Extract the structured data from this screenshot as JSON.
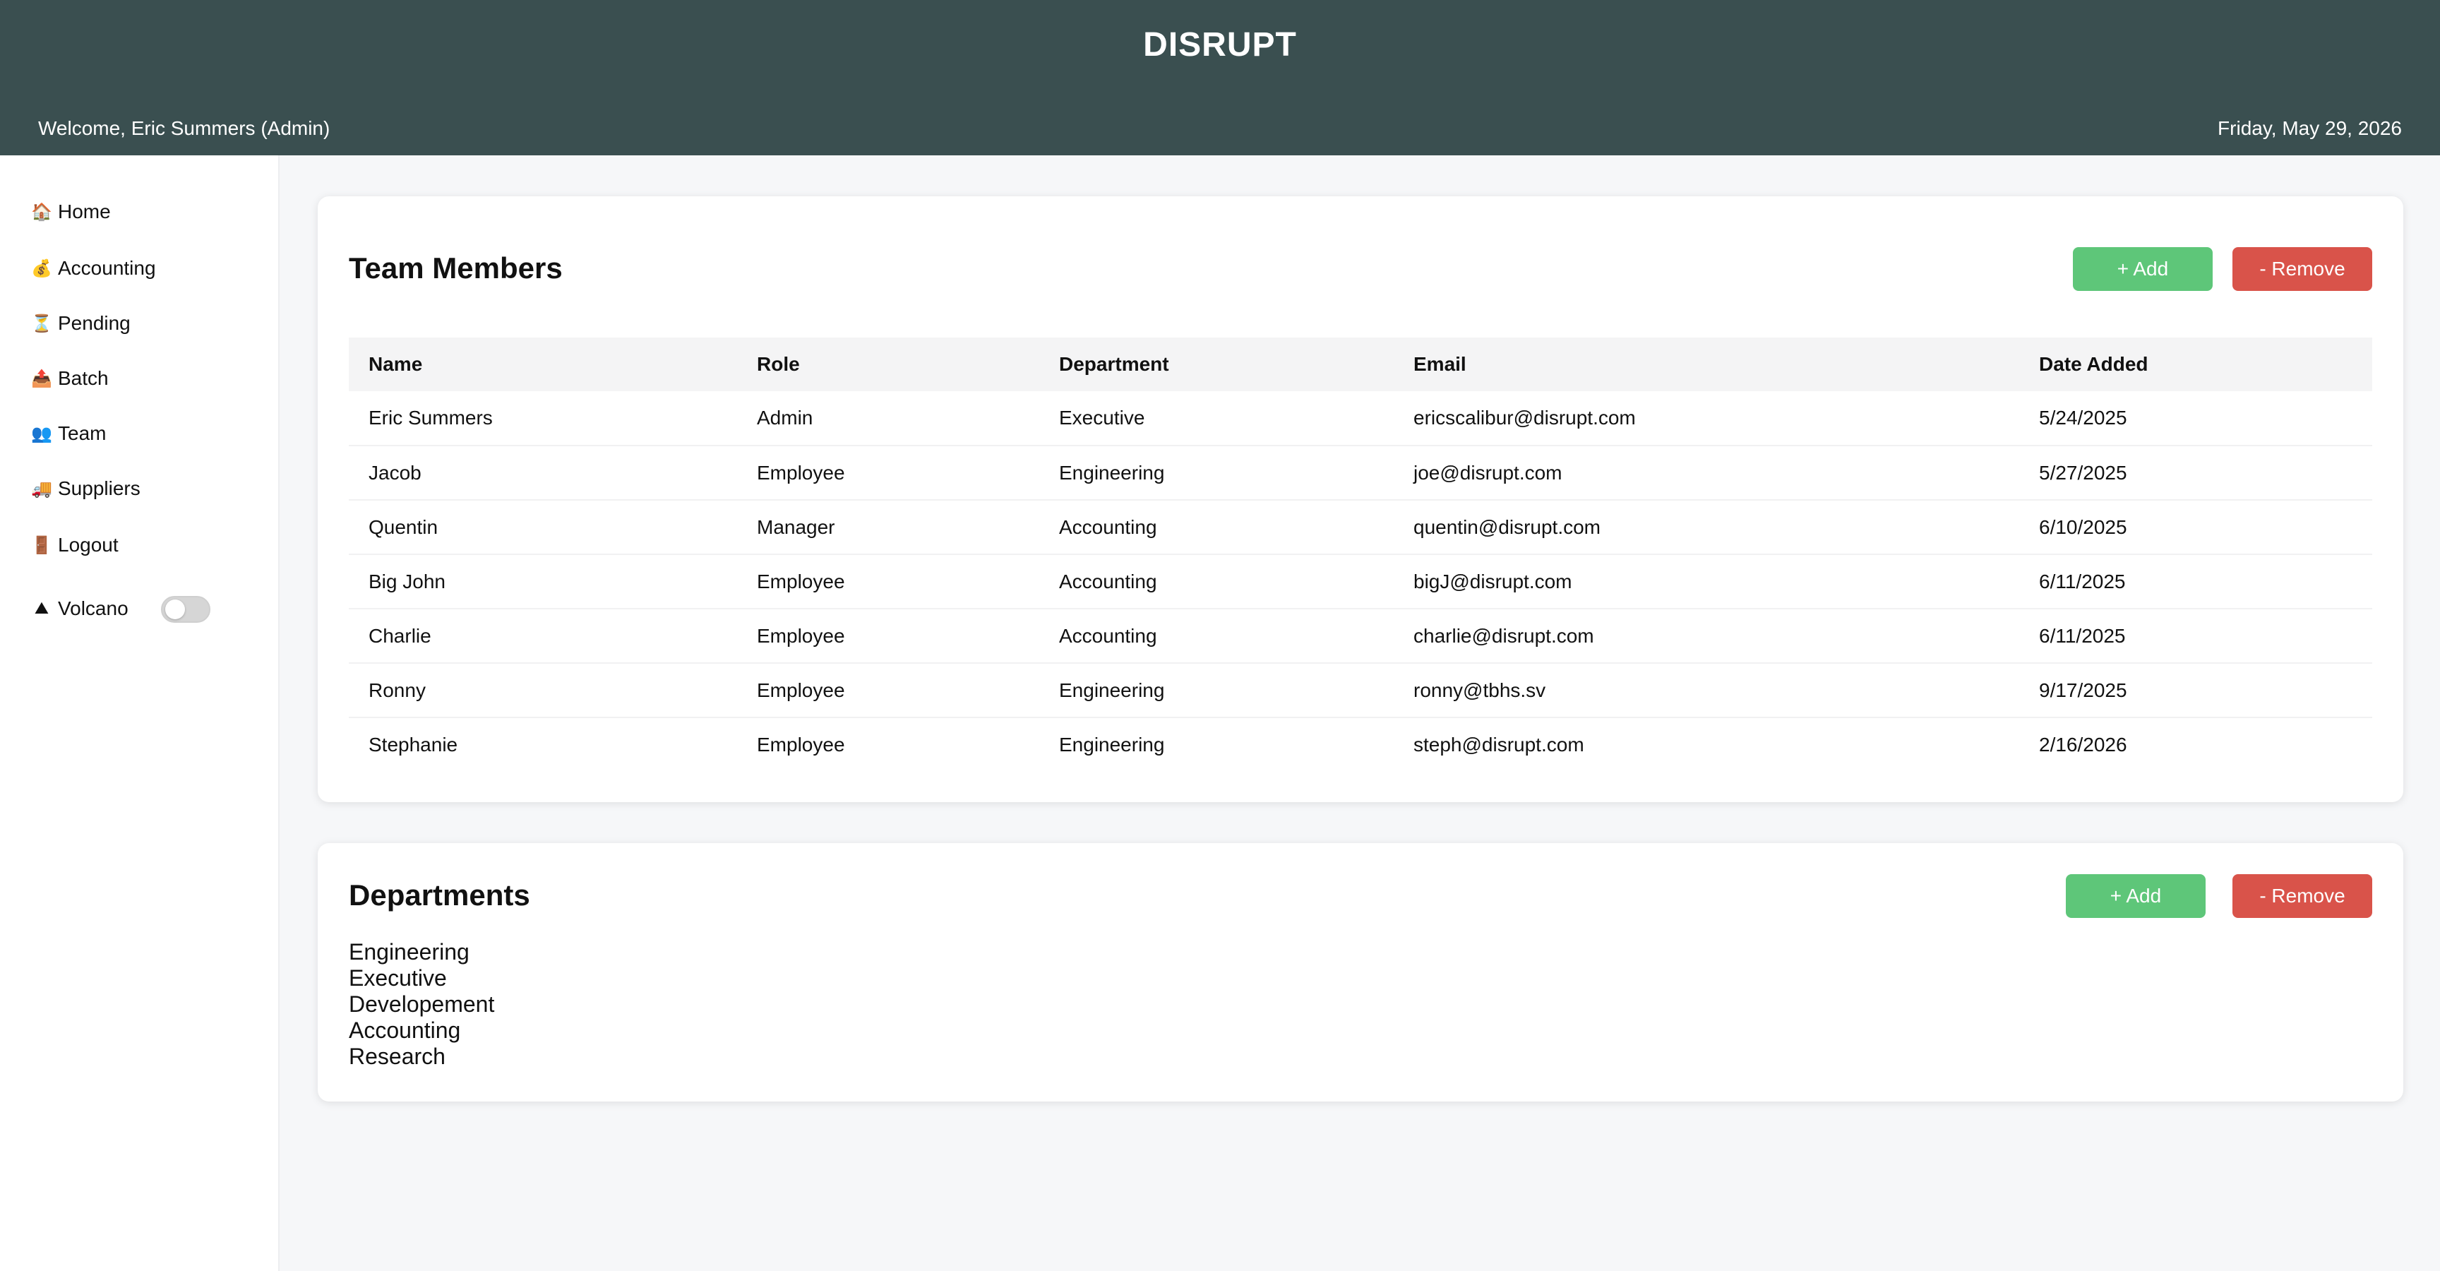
{
  "header": {
    "title": "DISRUPT",
    "welcome": "Welcome, Eric Summers (Admin)",
    "date": "Friday, May 29, 2026"
  },
  "sidebar": {
    "items": [
      {
        "label": "Home",
        "icon": "house-icon",
        "glyph": "🏠"
      },
      {
        "label": "Accounting",
        "icon": "money-bag-icon",
        "glyph": "💰"
      },
      {
        "label": "Pending",
        "icon": "hourglass-icon",
        "glyph": "⏳"
      },
      {
        "label": "Batch",
        "icon": "upload-icon",
        "glyph": "📤"
      },
      {
        "label": "Team",
        "icon": "people-icon",
        "glyph": "👥"
      },
      {
        "label": "Suppliers",
        "icon": "truck-icon",
        "glyph": "🚚"
      },
      {
        "label": "Logout",
        "icon": "door-icon",
        "glyph": "🚪"
      }
    ],
    "volcano": {
      "label": "Volcano",
      "icon": "mountain-icon",
      "glyph": "⛰",
      "enabled": false
    }
  },
  "team": {
    "title": "Team Members",
    "add_label": "+ Add",
    "remove_label": "- Remove",
    "columns": [
      "Name",
      "Role",
      "Department",
      "Email",
      "Date Added"
    ],
    "rows": [
      [
        "Eric Summers",
        "Admin",
        "Executive",
        "ericscalibur@disrupt.com",
        "5/24/2025"
      ],
      [
        "Jacob",
        "Employee",
        "Engineering",
        "joe@disrupt.com",
        "5/27/2025"
      ],
      [
        "Quentin",
        "Manager",
        "Accounting",
        "quentin@disrupt.com",
        "6/10/2025"
      ],
      [
        "Big John",
        "Employee",
        "Accounting",
        "bigJ@disrupt.com",
        "6/11/2025"
      ],
      [
        "Charlie",
        "Employee",
        "Accounting",
        "charlie@disrupt.com",
        "6/11/2025"
      ],
      [
        "Ronny",
        "Employee",
        "Engineering",
        "ronny@tbhs.sv",
        "9/17/2025"
      ],
      [
        "Stephanie",
        "Employee",
        "Engineering",
        "steph@disrupt.com",
        "2/16/2026"
      ]
    ]
  },
  "departments": {
    "title": "Departments",
    "add_label": "+ Add",
    "remove_label": "- Remove",
    "items": [
      "Engineering",
      "Executive",
      "Developement",
      "Accounting",
      "Research"
    ]
  },
  "colors": {
    "header_bg": "#3a4f50",
    "add_button": "#5ec679",
    "remove_button": "#d9534a"
  }
}
